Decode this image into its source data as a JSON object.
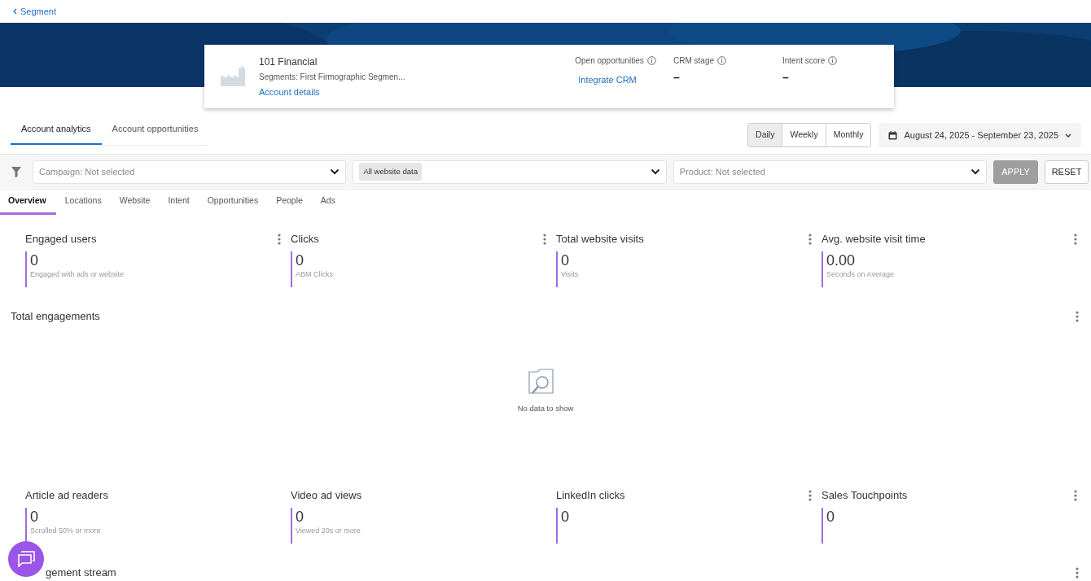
{
  "back_link": {
    "label": "Segment"
  },
  "account": {
    "name": "101 Financial",
    "segments": "Segments: First Firmographic Segmen...",
    "details_link": "Account details",
    "stats": [
      {
        "label": "Open opportunities",
        "kind": "link",
        "value": "Integrate CRM"
      },
      {
        "label": "CRM stage",
        "kind": "dash",
        "value": "–"
      },
      {
        "label": "Intent score",
        "kind": "dash",
        "value": "–"
      }
    ]
  },
  "tabs": [
    {
      "label": "Account analytics",
      "selected": true
    },
    {
      "label": "Account opportunities",
      "selected": false
    }
  ],
  "granularity": [
    {
      "label": "Daily",
      "selected": true
    },
    {
      "label": "Weekly",
      "selected": false
    },
    {
      "label": "Monthly",
      "selected": false
    }
  ],
  "date_range": "August 24, 2025 - September 23, 2025",
  "filters": [
    {
      "kind": "placeholder",
      "text": "Campaign: Not selected"
    },
    {
      "kind": "chip",
      "text": "All website data"
    },
    {
      "kind": "placeholder",
      "text": "Product: Not selected"
    }
  ],
  "apply_button": {
    "label": "APPLY",
    "disabled": true
  },
  "reset_button": {
    "label": "RESET"
  },
  "subtabs": [
    {
      "label": "Overview",
      "selected": true
    },
    {
      "label": "Locations",
      "selected": false
    },
    {
      "label": "Website",
      "selected": false
    },
    {
      "label": "Intent",
      "selected": false
    },
    {
      "label": "Opportunities",
      "selected": false
    },
    {
      "label": "People",
      "selected": false
    },
    {
      "label": "Ads",
      "selected": false
    }
  ],
  "metrics_top": [
    {
      "title": "Engaged users",
      "value": "0",
      "caption": "Engaged with ads or website",
      "menu": true
    },
    {
      "title": "Clicks",
      "value": "0",
      "caption": "ABM Clicks",
      "menu": true
    },
    {
      "title": "Total website visits",
      "value": "0",
      "caption": "Visits",
      "menu": true
    },
    {
      "title": "Avg. website visit time",
      "value": "0.00",
      "caption": "Seconds on Average",
      "menu": true
    }
  ],
  "total_engagements": {
    "title": "Total engagements",
    "empty_text": "No data to show"
  },
  "metrics_bottom": [
    {
      "title": "Article ad readers",
      "value": "0",
      "caption": "Scrolled 50% or more",
      "menu": false
    },
    {
      "title": "Video ad views",
      "value": "0",
      "caption": "Viewed 20s or more",
      "menu": false
    },
    {
      "title": "LinkedIn clicks",
      "value": "0",
      "menu": true
    },
    {
      "title": "Sales Touchpoints",
      "value": "0",
      "menu": true
    }
  ],
  "engagement_stream": {
    "title": "gement stream"
  }
}
